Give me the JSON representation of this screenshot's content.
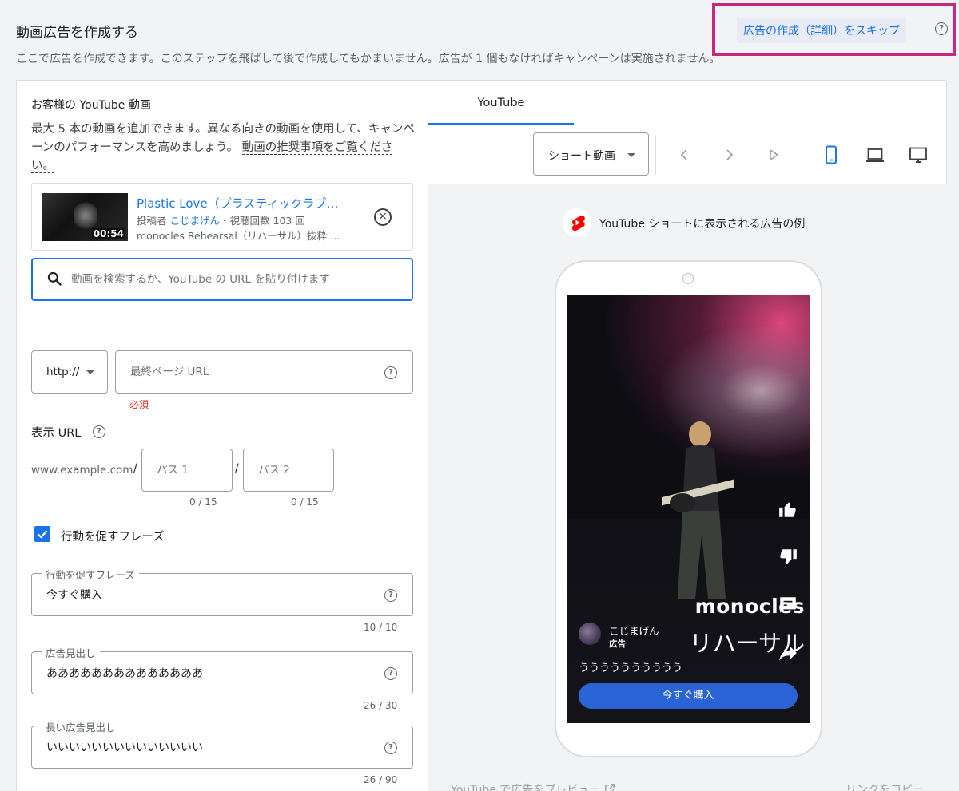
{
  "header": {
    "title": "動画広告を作成する",
    "description": "ここで広告を作成できます。このステップを飛ばして後で作成してもかまいません。広告が 1 個もなければキャンペーンは実施されません。",
    "skip_label": "広告の作成（詳細）をスキップ",
    "skip_highlight_color": "#c8287f"
  },
  "video_section": {
    "title": "お客様の YouTube 動画",
    "description": "最大 5 本の動画を追加できます。異なる向きの動画を使用して、キャンペーンのパフォーマンスを高めましょう。",
    "link": "動画の推奨事項をご覧ください。",
    "video": {
      "title": "Plastic Love（プラスティックラブ…",
      "meta_prefix": "投稿者",
      "channel": "こじまげん",
      "views": "・視聴回数 103 回",
      "desc": "monocles Rehearsal（リハーサル）抜粋 …",
      "duration": "00:54"
    },
    "search_placeholder": "動画を検索するか、YouTube の URL を貼り付けます"
  },
  "url_section": {
    "protocol": "http://",
    "final_url_placeholder": "最終ページ URL",
    "required": "必須",
    "display_url_label": "表示 URL",
    "domain": "www.example.com",
    "path1_placeholder": "パス 1",
    "path2_placeholder": "パス 2",
    "path1_counter": "0 / 15",
    "path2_counter": "0 / 15"
  },
  "cta_section": {
    "checkbox_label": "行動を促すフレーズ",
    "checked": true,
    "cta_label": "行動を促すフレーズ",
    "cta_value": "今すぐ購入",
    "cta_counter": "10 / 10",
    "headline_label": "広告見出し",
    "headline_value": "ああああああああああああああ",
    "headline_counter": "26 / 30",
    "long_headline_label": "長い広告見出し",
    "long_headline_value": "いいいいいいいいいいいいいい",
    "long_headline_counter": "26 / 90"
  },
  "preview": {
    "tab": "YouTube",
    "format": "ショート動画",
    "label": "YouTube ショートに表示される広告の例",
    "screen": {
      "overlay_line1": "monocles",
      "overlay_line2": "リハーサル",
      "channel": "こじまげん",
      "ad_tag": "広告",
      "description": "うううううううううう",
      "cta": "今すぐ購入"
    },
    "footer_left": "YouTube で広告をプレビュー",
    "footer_right": "リンクをコピー"
  },
  "colors": {
    "accent": "#1a73e8",
    "error": "#d93025",
    "cta_button": "#2a63d4"
  }
}
